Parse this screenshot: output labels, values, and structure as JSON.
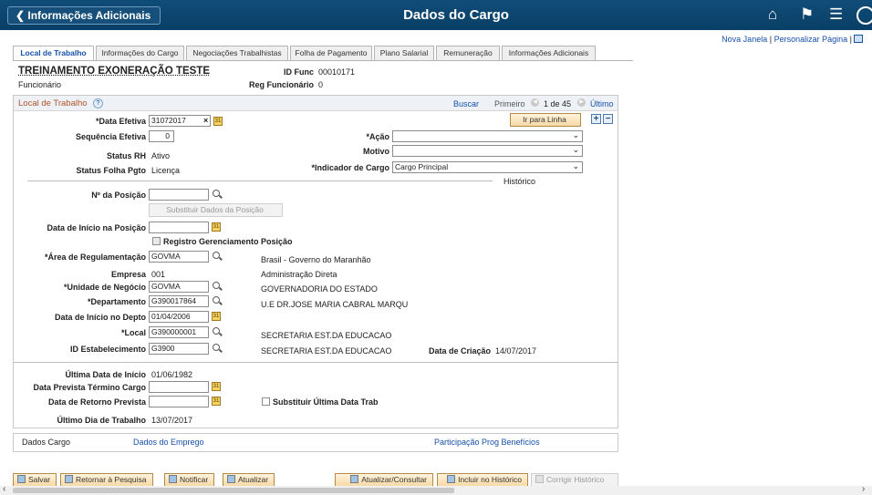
{
  "header": {
    "back_label": "Informações Adicionais",
    "title": "Dados do Cargo",
    "icons": [
      "home-icon",
      "flag-icon",
      "menu-icon",
      "navbar-icon"
    ]
  },
  "top_links": {
    "new_window": "Nova Janela",
    "personalize": "Personalizar Página"
  },
  "tabs": [
    "Local de Trabalho",
    "Informações do Cargo",
    "Negociações Trabalhistas",
    "Folha de Pagamento",
    "Plano Salarial",
    "Remuneração",
    "Informações Adicionais"
  ],
  "employee": {
    "name": "TREINAMENTO EXONERAÇÃO TESTE",
    "type": "Funcionário",
    "id_label": "ID Func",
    "id_value": "00010171",
    "reg_label": "Reg Funcionário",
    "reg_value": "0"
  },
  "section": {
    "title": "Local de Trabalho",
    "help": "?",
    "search": "Buscar",
    "first": "Primeiro",
    "counter": "1 de 45",
    "last": "Último",
    "goto": "Ir para Linha"
  },
  "fields": {
    "data_efetiva_label": "*Data Efetiva",
    "data_efetiva": "31072017",
    "sequencia_label": "Sequência Efetiva",
    "sequencia": "0",
    "status_rh_label": "Status RH",
    "status_rh": "Ativo",
    "status_folha_label": "Status Folha Pgto",
    "status_folha": "Licença",
    "acao_label": "*Ação",
    "acao": "",
    "motivo_label": "Motivo",
    "motivo": "",
    "indicador_label": "*Indicador de Cargo",
    "indicador": "Cargo Principal",
    "historico": "Histórico",
    "posicao_label": "Nº da Posição",
    "posicao": "",
    "substituir_btn": "Substituir Dados da Posição",
    "inicio_posicao_label": "Data de Início na Posição",
    "inicio_posicao": "",
    "registro_label": "Registro Gerenciamento Posição",
    "area_label": "*Área de Regulamentação",
    "area": "GOVMA",
    "area_desc": "Brasil - Governo do Maranhão",
    "empresa_label": "Empresa",
    "empresa": "001",
    "empresa_desc": "Administração Direta",
    "unidade_label": "*Unidade de Negócio",
    "unidade": "GOVMA",
    "unidade_desc": "GOVERNADORIA DO ESTADO",
    "depto_label": "*Departamento",
    "depto": "G390017864",
    "depto_desc": "U.E DR.JOSE MARIA CABRAL MARQU",
    "inicio_depto_label": "Data de Início no Depto",
    "inicio_depto": "01/04/2006",
    "local_label": "*Local",
    "local": "G390000001",
    "local_desc": "SECRETARIA EST.DA EDUCACAO",
    "estab_label": "ID Estabelecimento",
    "estab": "G3900",
    "estab_desc": "SECRETARIA EST.DA EDUCACAO",
    "criacao_label": "Data de Criação",
    "criacao": "14/07/2017",
    "ultima_inicio_label": "Última Data de Início",
    "ultima_inicio": "01/06/1982",
    "prevista_termino_label": "Data Prevista Término Cargo",
    "prevista_termino": "",
    "retorno_label": "Data de Retorno Prevista",
    "retorno": "",
    "substituir_ultima_label": "Substituir Última Data Trab",
    "ultimo_dia_label": "Último Dia de Trabalho",
    "ultimo_dia": "13/07/2017"
  },
  "links": {
    "dados_cargo": "Dados Cargo",
    "dados_emprego": "Dados do Emprego",
    "participacao": "Participação Prog Benefícios"
  },
  "toolbar": {
    "save": "Salvar",
    "return": "Retornar à Pesquisa",
    "notify": "Notificar",
    "refresh": "Atualizar",
    "update_display": "Atualizar/Consultar",
    "include_history": "Incluir no Histórico",
    "correct_history": "Corrigir Histórico"
  }
}
